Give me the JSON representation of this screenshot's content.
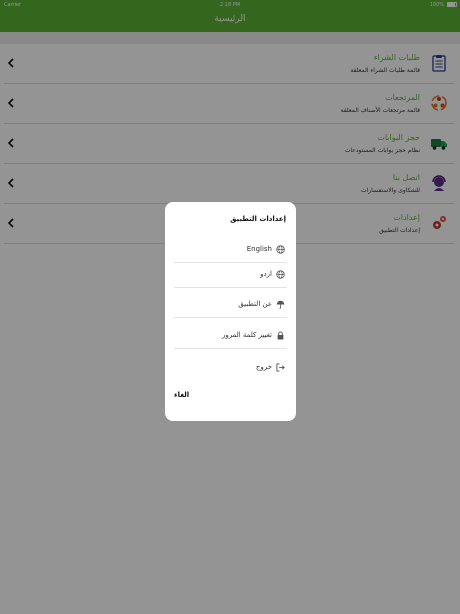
{
  "status_bar": {
    "carrier": "Carrier",
    "time": "2:18 PM",
    "battery": "100%"
  },
  "nav": {
    "title": "الرئيسية"
  },
  "menu": {
    "items": [
      {
        "title": "طلبات الشراء",
        "subtitle": "قائمة طلبات الشراء المعلقة",
        "icon": "clipboard-icon"
      },
      {
        "title": "المرتجعات",
        "subtitle": "قائمة مرتجعات الأصناف المعلقة",
        "icon": "returns-icon"
      },
      {
        "title": "حجز البوابات",
        "subtitle": "نظام حجز بوابات المستودعات",
        "icon": "truck-icon"
      },
      {
        "title": "اتصل بنا",
        "subtitle": "للشكاوى والاستفسارات",
        "icon": "support-agent-icon"
      },
      {
        "title": "إعدادات",
        "subtitle": "إعدادات التطبيق",
        "icon": "gears-icon"
      }
    ]
  },
  "dialog": {
    "title": "إعدادات التطبيق",
    "options": [
      {
        "label": "English",
        "icon": "globe-icon"
      },
      {
        "label": "اردو",
        "icon": "globe-icon"
      },
      {
        "label": "عن التطبيق",
        "icon": "umbrella-icon"
      },
      {
        "label": "تغيير كلمة المرور",
        "icon": "lock-icon"
      },
      {
        "label": "خروج",
        "icon": "logout-icon"
      }
    ],
    "cancel_label": "الغاء"
  },
  "colors": {
    "brand_green": "#5bb034",
    "overlay": "rgba(0,0,0,0.42)"
  }
}
